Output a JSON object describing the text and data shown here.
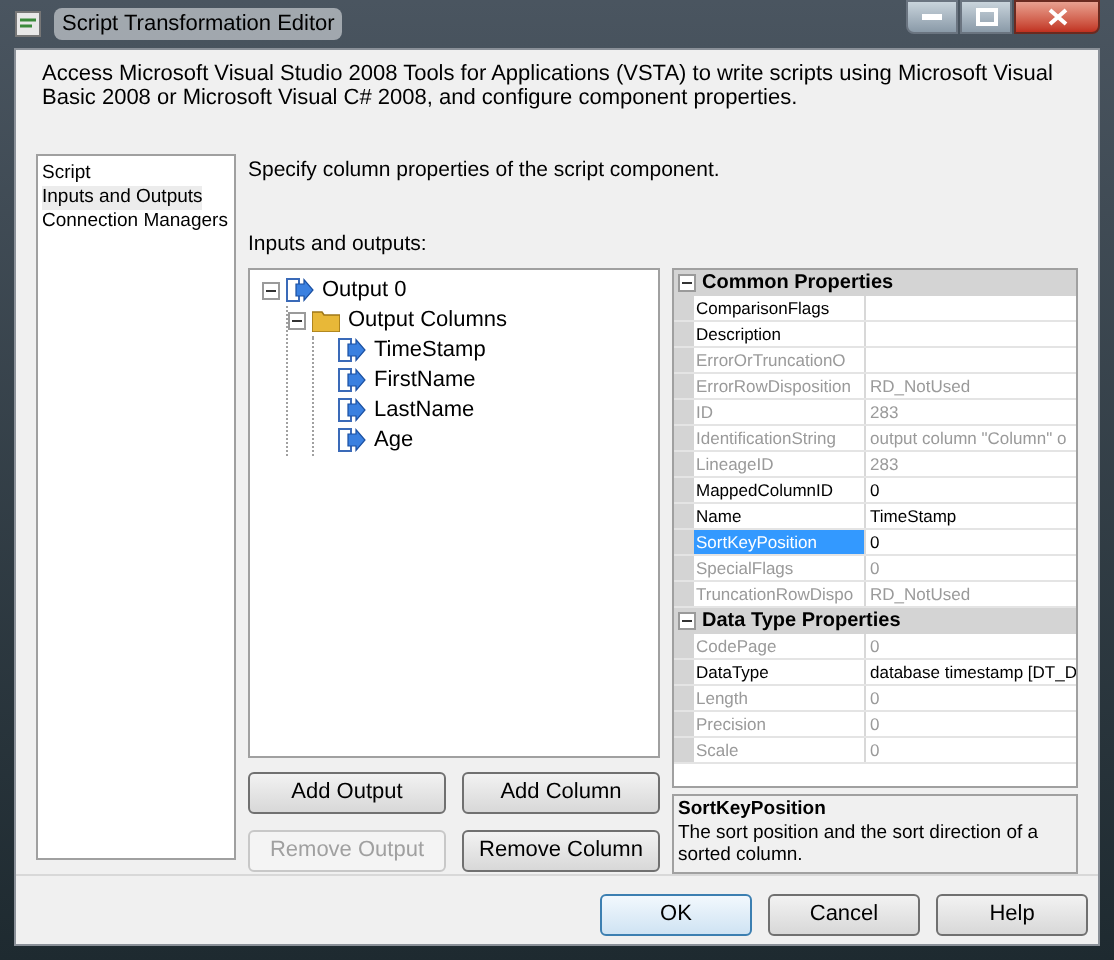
{
  "window": {
    "title": "Script Transformation Editor"
  },
  "intro": "Access Microsoft Visual Studio 2008 Tools for Applications (VSTA) to write scripts using Microsoft Visual Basic 2008 or Microsoft Visual C# 2008, and configure component properties.",
  "sidebar": {
    "items": [
      {
        "label": "Script",
        "selected": false
      },
      {
        "label": "Inputs and Outputs",
        "selected": true
      },
      {
        "label": "Connection Managers",
        "selected": false
      }
    ]
  },
  "heading": "Specify column properties of the script component.",
  "tree_label": "Inputs and outputs:",
  "tree": [
    {
      "label": "Output 0",
      "kind": "output",
      "expanded": true,
      "children": [
        {
          "label": "Output Columns",
          "kind": "folder",
          "expanded": true,
          "children": [
            {
              "label": "TimeStamp",
              "kind": "column"
            },
            {
              "label": "FirstName",
              "kind": "column"
            },
            {
              "label": "LastName",
              "kind": "column"
            },
            {
              "label": "Age",
              "kind": "column"
            }
          ]
        }
      ]
    }
  ],
  "properties": [
    {
      "category": "Common Properties",
      "expanded": true,
      "rows": [
        {
          "name": "ComparisonFlags",
          "value": "",
          "disabled": false,
          "selected": false
        },
        {
          "name": "Description",
          "value": "",
          "disabled": false,
          "selected": false
        },
        {
          "name": "ErrorOrTruncationO",
          "value": "",
          "disabled": true,
          "selected": false
        },
        {
          "name": "ErrorRowDisposition",
          "value": "RD_NotUsed",
          "disabled": true,
          "selected": false
        },
        {
          "name": "ID",
          "value": "283",
          "disabled": true,
          "selected": false
        },
        {
          "name": "IdentificationString",
          "value": "output column \"Column\" o",
          "disabled": true,
          "selected": false
        },
        {
          "name": "LineageID",
          "value": "283",
          "disabled": true,
          "selected": false
        },
        {
          "name": "MappedColumnID",
          "value": "0",
          "disabled": false,
          "selected": false
        },
        {
          "name": "Name",
          "value": "TimeStamp",
          "disabled": false,
          "selected": false
        },
        {
          "name": "SortKeyPosition",
          "value": "0",
          "disabled": false,
          "selected": true
        },
        {
          "name": "SpecialFlags",
          "value": "0",
          "disabled": true,
          "selected": false
        },
        {
          "name": "TruncationRowDispo",
          "value": "RD_NotUsed",
          "disabled": true,
          "selected": false
        }
      ]
    },
    {
      "category": "Data Type Properties",
      "expanded": true,
      "rows": [
        {
          "name": "CodePage",
          "value": "0",
          "disabled": true,
          "selected": false
        },
        {
          "name": "DataType",
          "value": "database timestamp [DT_D",
          "disabled": false,
          "selected": false
        },
        {
          "name": "Length",
          "value": "0",
          "disabled": true,
          "selected": false
        },
        {
          "name": "Precision",
          "value": "0",
          "disabled": true,
          "selected": false
        },
        {
          "name": "Scale",
          "value": "0",
          "disabled": true,
          "selected": false
        }
      ]
    }
  ],
  "property_help": {
    "title": "SortKeyPosition",
    "text": "The sort position and the sort direction of a sorted column."
  },
  "tree_buttons": [
    {
      "label": "Add Output",
      "disabled": false
    },
    {
      "label": "Add Column",
      "disabled": false
    },
    {
      "label": "Remove Output",
      "disabled": true
    },
    {
      "label": "Remove Column",
      "disabled": false
    }
  ],
  "buttons": [
    {
      "label": "OK",
      "default": true
    },
    {
      "label": "Cancel",
      "default": false
    },
    {
      "label": "Help",
      "default": false
    }
  ]
}
